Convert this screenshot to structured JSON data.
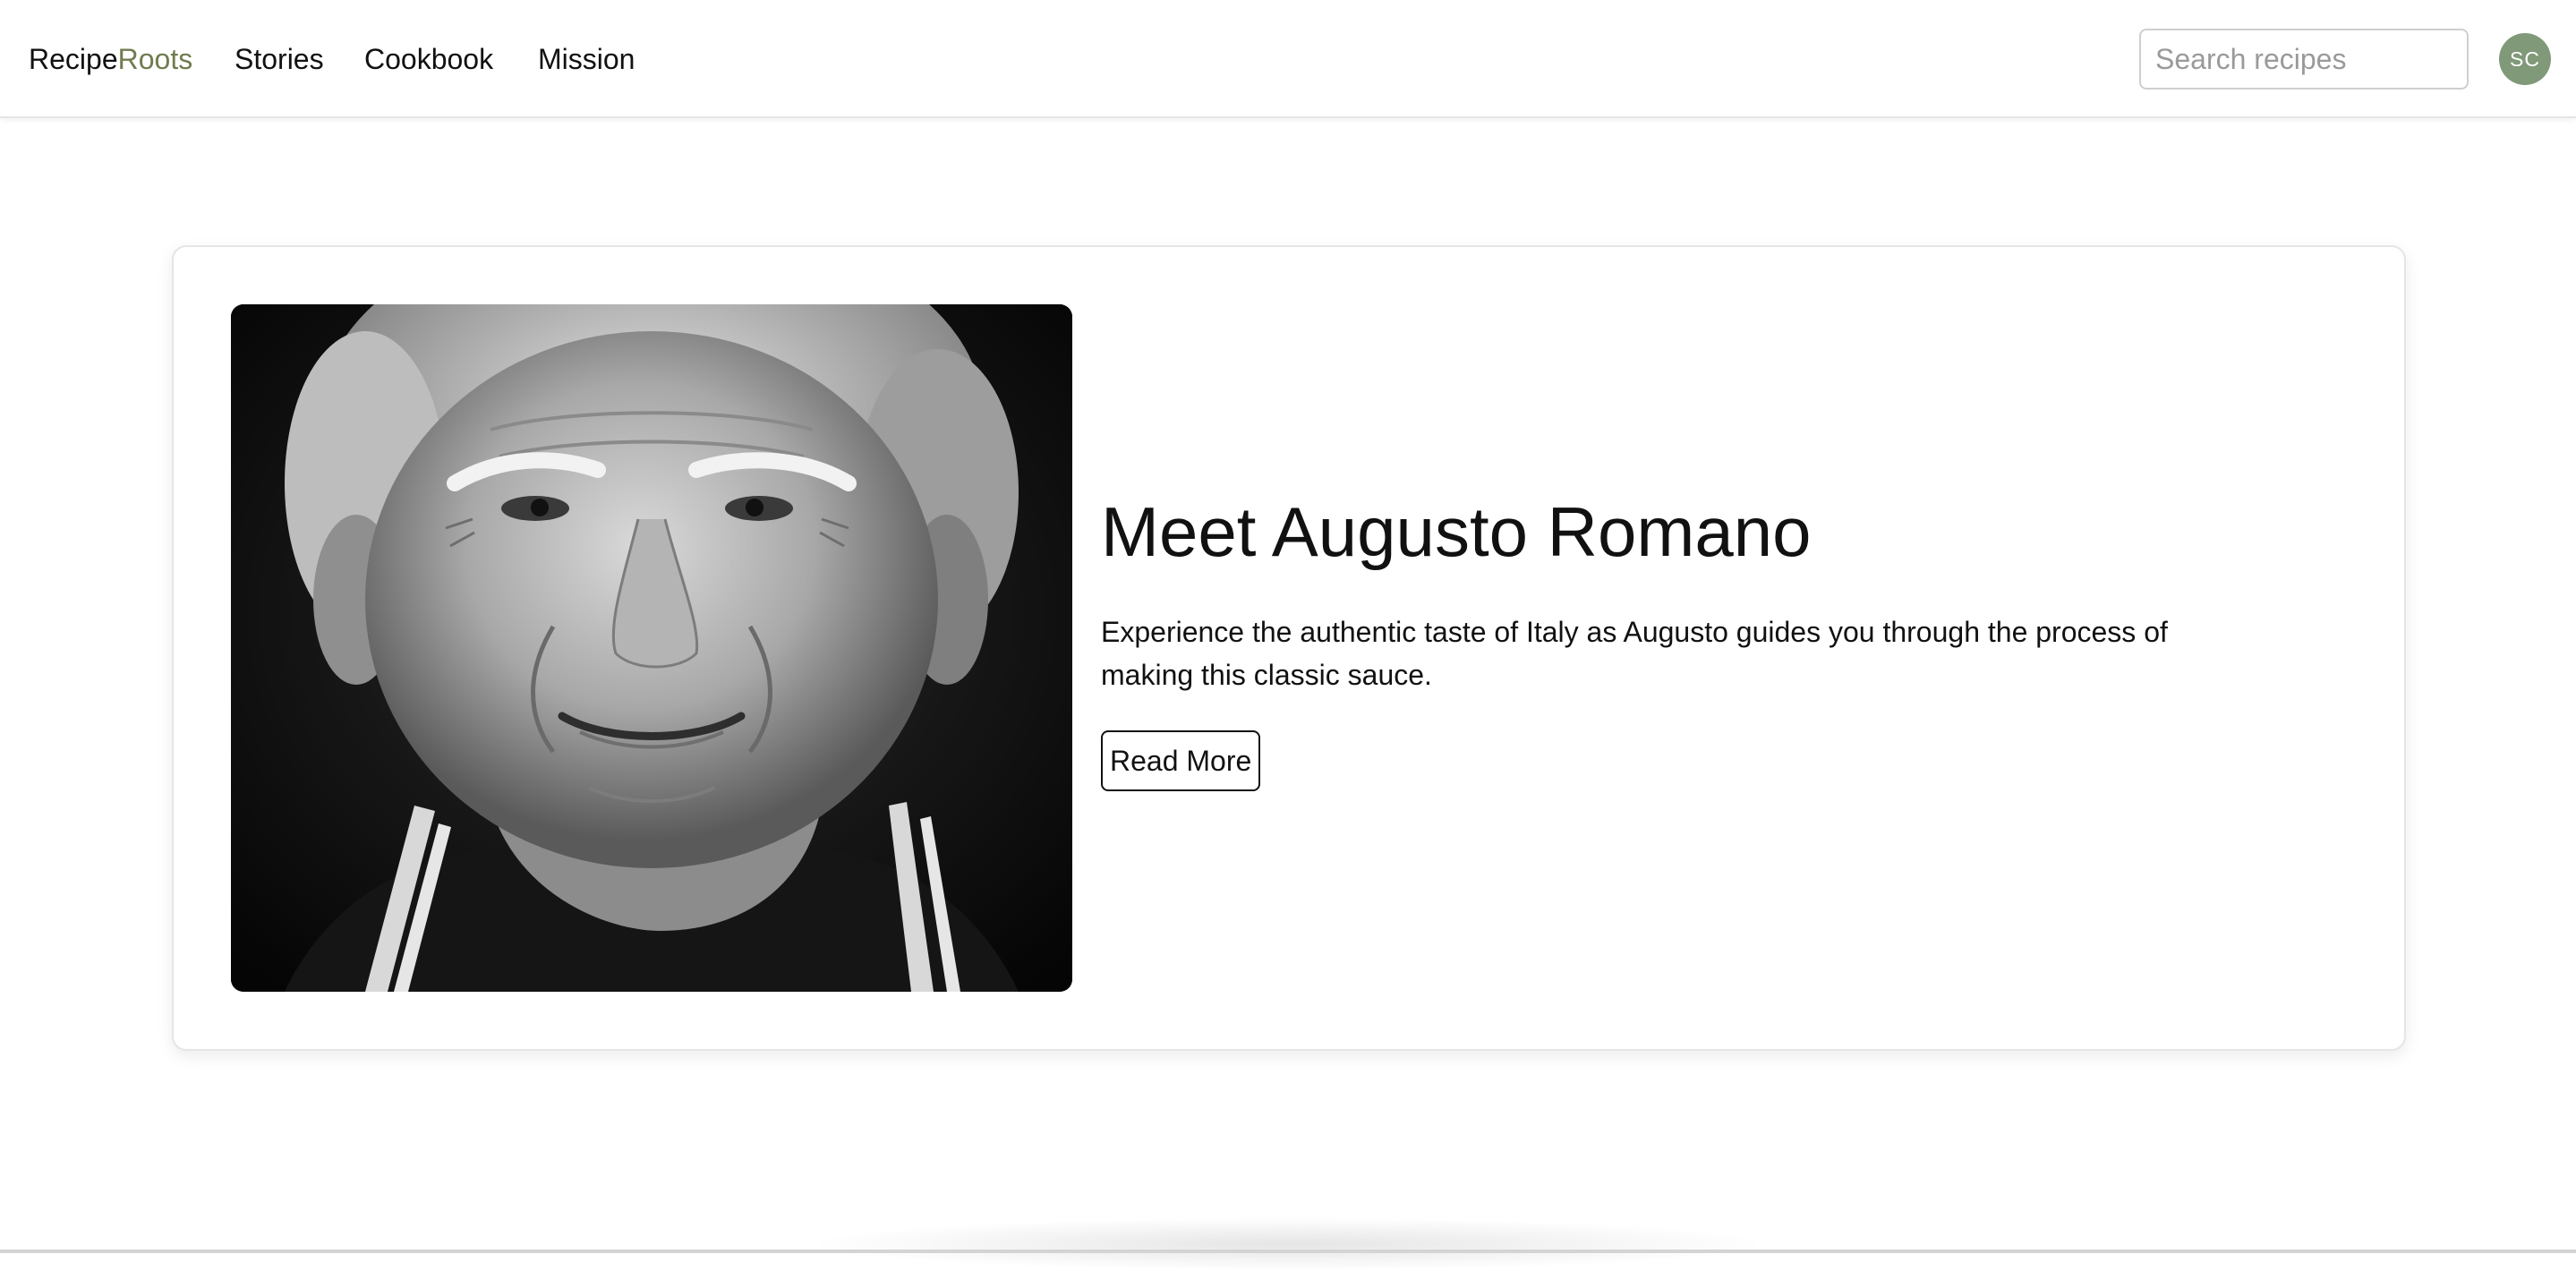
{
  "theme": {
    "accent": "#6f7c4f",
    "avatar": "#809978"
  },
  "nav": {
    "brand_part1": "Recipe",
    "brand_part2": "Roots",
    "links": [
      "Stories",
      "Cookbook",
      "Mission"
    ],
    "search": {
      "placeholder": "Search recipes",
      "value": ""
    },
    "avatar_initials": "SC"
  },
  "feature": {
    "title": "Meet Augusto Romano",
    "description": "Experience the authentic taste of Italy as Augusto guides you through the process of making this classic sauce.",
    "button_label": "Read More",
    "image": "elderly-man-portrait-bw"
  }
}
